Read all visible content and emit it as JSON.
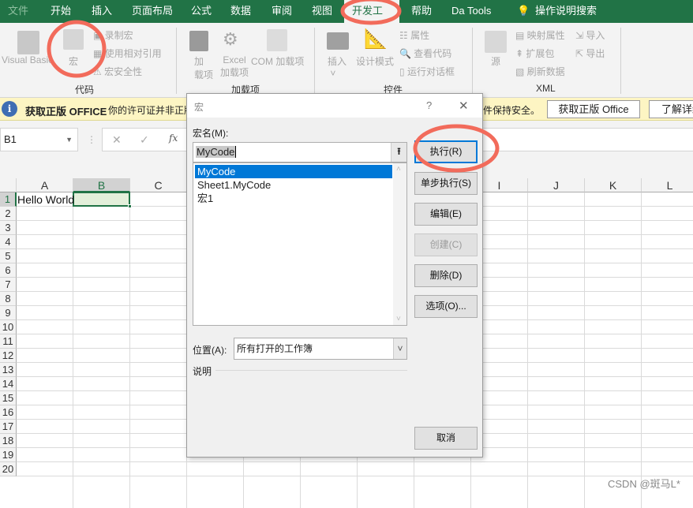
{
  "menu": {
    "tabs": [
      "文件",
      "开始",
      "插入",
      "页面布局",
      "公式",
      "数据",
      "审阅",
      "视图",
      "开发工具",
      "帮助",
      "Da Tools"
    ],
    "active": "开发工具",
    "search": "操作说明搜索"
  },
  "ribbon": {
    "code": {
      "visual_basic": "Visual Basic",
      "macros": "宏",
      "record": "录制宏",
      "relative": "使用相对引用",
      "security": "宏安全性",
      "group": "代码"
    },
    "addins": {
      "addins_1": "加",
      "addins_2": "载项",
      "excel_1": "Excel",
      "excel_2": "加载项",
      "com": "COM 加载项",
      "group": "加载项"
    },
    "controls": {
      "insert": "插入",
      "design": "设计模式",
      "properties": "属性",
      "view_code": "查看代码",
      "run_dialog": "运行对话框",
      "group": "控件"
    },
    "xml": {
      "source": "源",
      "map": "映射属性",
      "expansion": "扩展包",
      "refresh": "刷新数据",
      "import": "导入",
      "export": "导出",
      "group": "XML"
    }
  },
  "infobar": {
    "title": "获取正版 OFFICE",
    "message": "你的许可证并非正版",
    "message_tail": "件保持安全。",
    "get_button": "获取正版 Office",
    "learn_button": "了解详细"
  },
  "formula_bar": {
    "name_box": "B1",
    "cancel": "✕",
    "enter": "✓",
    "fx": "fx"
  },
  "sheet": {
    "columns": [
      "A",
      "B",
      "C",
      "D",
      "E",
      "F",
      "G",
      "H",
      "I",
      "J",
      "K",
      "L"
    ],
    "rows": [
      "1",
      "2",
      "3",
      "4",
      "5",
      "6",
      "7",
      "8",
      "9",
      "10",
      "11",
      "12",
      "13",
      "14",
      "15",
      "16",
      "17",
      "18",
      "19",
      "20"
    ],
    "cell_A1": "Hello World",
    "selected": "B1"
  },
  "dialog": {
    "title": "宏",
    "help": "?",
    "close": "✕",
    "name_label": "宏名(M):",
    "name_value": "MyCode",
    "macros": [
      "MyCode",
      "Sheet1.MyCode",
      "宏1"
    ],
    "selected_macro": "MyCode",
    "location_label": "位置(A):",
    "location_value": "所有打开的工作簿",
    "description_label": "说明",
    "buttons": {
      "run": "执行(R)",
      "step": "单步执行(S)",
      "edit": "编辑(E)",
      "create": "创建(C)",
      "delete": "删除(D)",
      "options": "选项(O)...",
      "cancel": "取消"
    }
  },
  "watermark": "CSDN @斑马L*",
  "colors": {
    "excel_green": "#217346",
    "selection": "#0078d7",
    "annotation": "#f26b5b"
  }
}
